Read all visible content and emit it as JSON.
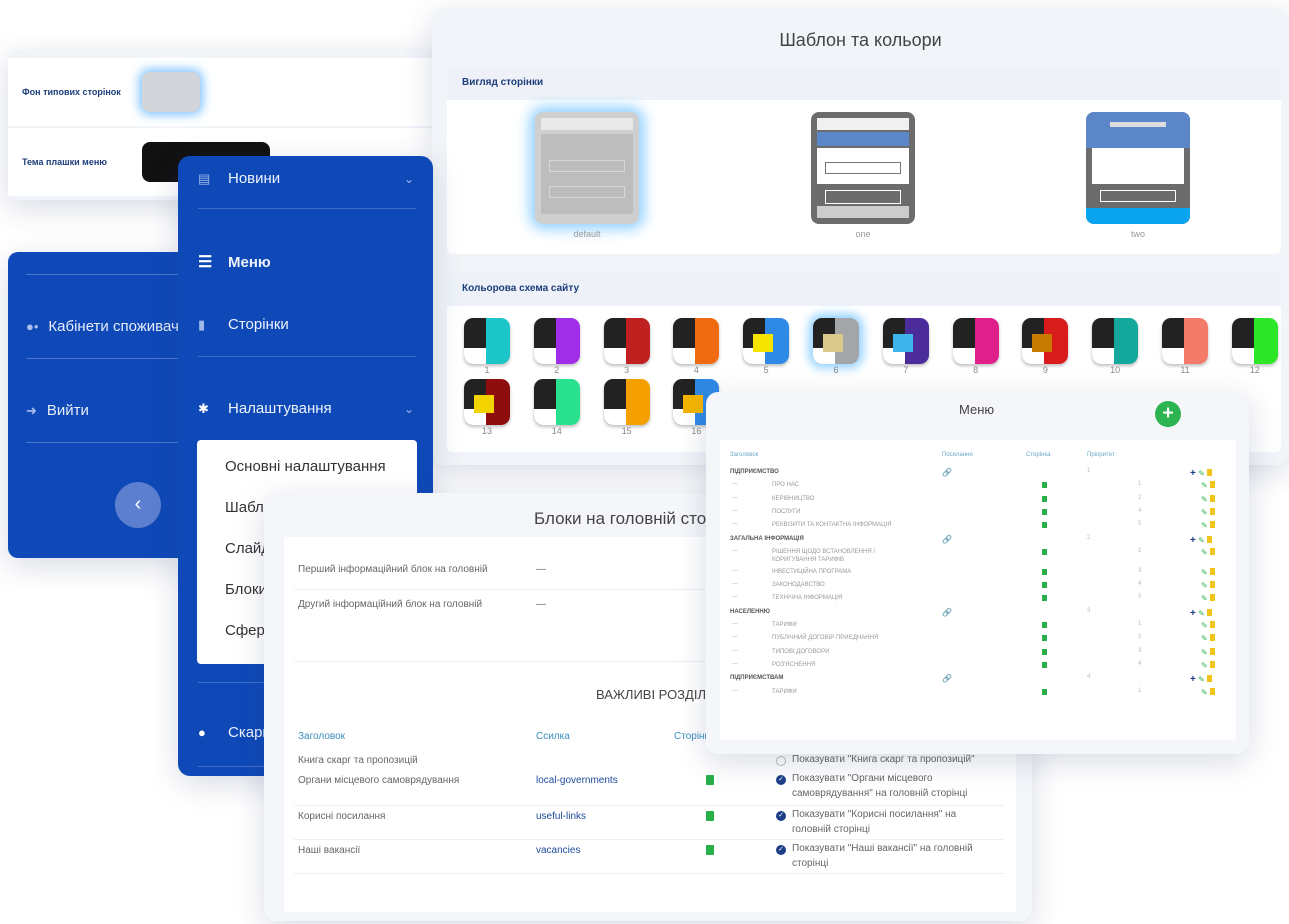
{
  "settings_panel": {
    "rows": [
      {
        "label": "Фон типових сторінок",
        "color": "#d2d5da"
      },
      {
        "label": "Тема плашки меню",
        "color": "#111111"
      }
    ]
  },
  "sidebar_back": {
    "items": [
      {
        "label": "Кабінети споживачів",
        "icon": "users-icon"
      },
      {
        "label": "Вийти",
        "icon": "logout-icon"
      }
    ],
    "collapse_icon": "‹"
  },
  "sidebar_front": {
    "items": [
      {
        "label": "Новини",
        "icon": "news-icon"
      },
      {
        "label": "Меню",
        "icon": "menu-icon"
      },
      {
        "label": "Сторінки",
        "icon": "page-icon"
      },
      {
        "label": "Налаштування",
        "icon": "gear-icon"
      },
      {
        "label": "Скарги",
        "icon": "alert-icon"
      }
    ],
    "submenu": [
      "Основні налаштування",
      "Шаблон та кольори",
      "Слайдер",
      "Блоки на головній",
      "Сфери"
    ]
  },
  "template_panel": {
    "title": "Шаблон та кольори",
    "view_section": "Вигляд сторінки",
    "templates": [
      "default",
      "one",
      "two"
    ],
    "scheme_section": "Кольорова схема сайту",
    "schemes": [
      {
        "n": "1",
        "c": "#1cc6c8",
        "a": ""
      },
      {
        "n": "2",
        "c": "#a02ee8",
        "a": ""
      },
      {
        "n": "3",
        "c": "#c12020",
        "a": ""
      },
      {
        "n": "4",
        "c": "#ee6b12",
        "a": ""
      },
      {
        "n": "5",
        "c": "#2f8ae5",
        "a": "#f4e400"
      },
      {
        "n": "6",
        "c": "#a2a6a8",
        "a": "#d9c98c"
      },
      {
        "n": "7",
        "c": "#4c2c9a",
        "a": "#3fb4ea"
      },
      {
        "n": "8",
        "c": "#e0208a",
        "a": ""
      },
      {
        "n": "9",
        "c": "#d81c1c",
        "a": "#c77a00"
      },
      {
        "n": "10",
        "c": "#14a89c",
        "a": ""
      },
      {
        "n": "11",
        "c": "#f47b6a",
        "a": ""
      },
      {
        "n": "12",
        "c": "#2ee628",
        "a": ""
      },
      {
        "n": "13",
        "c": "#8e0e0e",
        "a": "#f4d400"
      },
      {
        "n": "14",
        "c": "#28e08e",
        "a": ""
      },
      {
        "n": "15",
        "c": "#f4a000",
        "a": ""
      },
      {
        "n": "16",
        "c": "#2f8ae5",
        "a": "#f4b400"
      }
    ]
  },
  "blocks_panel": {
    "title": "Блоки на головній сторінці",
    "first_block": "Перший інформаційний блок на головній",
    "second_block": "Другий інформаційний блок на головній",
    "dash": "—",
    "section": "ВАЖЛИВІ РОЗДІЛИ",
    "headers": [
      "Заголовок",
      "Ссилка",
      "Сторінка"
    ],
    "rows": [
      {
        "title": "Книга скарг та пропозицій",
        "link": "",
        "check": false,
        "check_text": "Показувати \"Книга скарг та пропозицій\""
      },
      {
        "title": "Органи місцевого самоврядування",
        "link": "local-governments",
        "check": true,
        "check_text": "Показувати \"Органи місцевого самоврядування\" на головній сторінці"
      },
      {
        "title": "Корисні посилання",
        "link": "useful-links",
        "check": true,
        "check_text": "Показувати \"Корисні посилання\" на головній сторінці"
      },
      {
        "title": "Наші вакансії",
        "link": "vacancies",
        "check": true,
        "check_text": "Показувати \"Наші вакансії\" на головній сторінці"
      }
    ]
  },
  "menu_panel": {
    "title": "Меню",
    "add_label": "+",
    "headers": [
      "Заголовок",
      "Посилання",
      "Сторінка",
      "Пріоритет"
    ],
    "rows": [
      {
        "t": "ПІДПРИЄМСТВО",
        "top": true,
        "p": "1"
      },
      {
        "t": "ПРО НАС",
        "p": "1"
      },
      {
        "t": "КЕРІВНИЦТВО",
        "p": "2"
      },
      {
        "t": "ПОСЛУГИ",
        "p": "4"
      },
      {
        "t": "РЕКВІЗИТИ ТА КОНТАКТНА ІНФОРМАЦІЯ",
        "p": "5"
      },
      {
        "t": "ЗАГАЛЬНА ІНФОРМАЦІЯ",
        "top": true,
        "p": "2"
      },
      {
        "t": "РІШЕННЯ ЩОДО ВСТАНОВЛЕННЯ / КОРИГУВАННЯ ТАРИФІВ",
        "p": "2",
        "tall": true
      },
      {
        "t": "ІНВЕСТИЦІЙНА ПРОГРАМА",
        "p": "3"
      },
      {
        "t": "ЗАКОНОДАВСТВО",
        "p": "4"
      },
      {
        "t": "ТЕХНІЧНА ІНФОРМАЦІЯ",
        "p": "5"
      },
      {
        "t": "НАСЕЛЕННЮ",
        "top": true,
        "p": "3"
      },
      {
        "t": "ТАРИФИ",
        "p": "1"
      },
      {
        "t": "ПУБЛІЧНИЙ ДОГОВІР ПРИЄДНАННЯ",
        "p": "2"
      },
      {
        "t": "ТИПОВІ ДОГОВОРИ",
        "p": "3"
      },
      {
        "t": "РОЗ'ЯСНЕННЯ",
        "p": "4"
      },
      {
        "t": "ПІДПРИЄМСТВАМ",
        "top": true,
        "p": "4"
      },
      {
        "t": "ТАРИФИ",
        "p": "1"
      }
    ]
  }
}
